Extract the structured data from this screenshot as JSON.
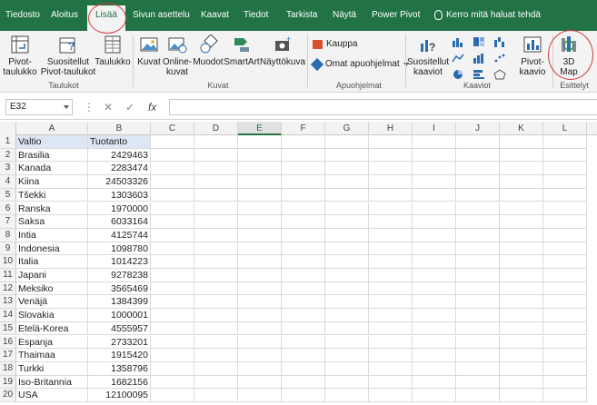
{
  "ribbon_tabs": [
    "Tiedosto",
    "Aloitus",
    "Lisää",
    "Sivun asettelu",
    "Kaavat",
    "Tiedot",
    "Tarkista",
    "Näytä",
    "Power Pivot"
  ],
  "tell_me": "Kerro mitä haluat tehdä",
  "active_tab": "Lisää",
  "groups": {
    "taulukot": {
      "label": "Taulukot",
      "buttons": [
        {
          "label": "Pivot-\ntaulukko",
          "icon": "pivot-table-icon"
        },
        {
          "label": "Suositellut\nPivot-taulukot",
          "icon": "recommended-pivot-icon"
        },
        {
          "label": "Taulukko",
          "icon": "table-icon"
        }
      ]
    },
    "kuvat": {
      "label": "Kuvat",
      "buttons": [
        {
          "label": "Kuvat",
          "icon": "picture-icon"
        },
        {
          "label": "Online-\nkuvat",
          "icon": "online-picture-icon"
        },
        {
          "label": "Muodot",
          "icon": "shapes-icon"
        },
        {
          "label": "SmartArt",
          "icon": "smartart-icon"
        },
        {
          "label": "Näyttökuva",
          "icon": "screenshot-icon"
        }
      ]
    },
    "apuohjelmat": {
      "label": "Apuohjelmat",
      "store": "Kauppa",
      "my_addins": "Omat apuohjelmat"
    },
    "kaaviot": {
      "label": "Kaaviot",
      "recommended": "Suositellut\nkaaviot",
      "pivot_chart": "Pivot-\nkaavio"
    },
    "esittelyt": {
      "label": "Esittelyt",
      "map3d": "3D\nMap"
    }
  },
  "namebox": "E32",
  "fx_label": "fx",
  "columns": [
    "A",
    "B",
    "C",
    "D",
    "E",
    "F",
    "G",
    "H",
    "I",
    "J",
    "K",
    "L"
  ],
  "selected_column": "E",
  "header_row": {
    "a": "Valtio",
    "b": "Tuotanto"
  },
  "rows": [
    {
      "a": "Brasilia",
      "b": "2429463"
    },
    {
      "a": "Kanada",
      "b": "2283474"
    },
    {
      "a": "Kiina",
      "b": "24503326"
    },
    {
      "a": " Tšekki",
      "b": "1303603"
    },
    {
      "a": "Ranska",
      "b": "1970000"
    },
    {
      "a": "Saksa",
      "b": "6033164"
    },
    {
      "a": "Intia",
      "b": "4125744"
    },
    {
      "a": "Indonesia",
      "b": "1098780"
    },
    {
      "a": "Italia",
      "b": "1014223"
    },
    {
      "a": "Japani",
      "b": "9278238"
    },
    {
      "a": "Meksiko",
      "b": "3565469"
    },
    {
      "a": "Venäjä",
      "b": "1384399"
    },
    {
      "a": "Slovakia",
      "b": "1000001"
    },
    {
      "a": "Etelä-Korea",
      "b": "4555957"
    },
    {
      "a": "Espanja",
      "b": "2733201"
    },
    {
      "a": "Thaimaa",
      "b": "1915420"
    },
    {
      "a": "Turkki",
      "b": "1358796"
    },
    {
      "a": "Iso-Britannia",
      "b": "1682156"
    },
    {
      "a": "USA",
      "b": "12100095"
    }
  ],
  "colors": {
    "excel_green": "#217346",
    "annotation_red": "#d23a3a"
  }
}
